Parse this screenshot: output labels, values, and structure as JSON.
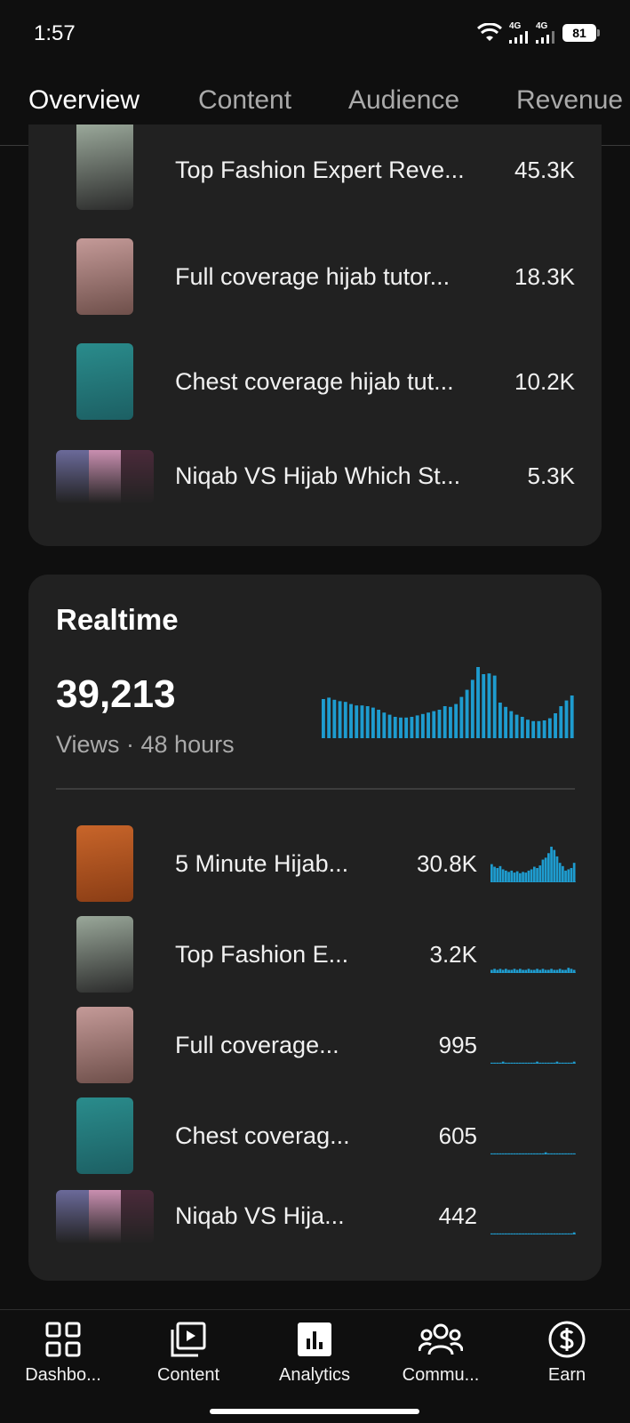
{
  "status": {
    "time": "1:57",
    "net1": "4G",
    "net2": "4G",
    "battery": "81"
  },
  "tabs": [
    {
      "label": "Overview",
      "active": true
    },
    {
      "label": "Content",
      "active": false
    },
    {
      "label": "Audience",
      "active": false
    },
    {
      "label": "Revenue",
      "active": false
    }
  ],
  "top_content": [
    {
      "title": "Top Fashion Expert Reve...",
      "value": "45.3K",
      "thumb": [
        "#9aa89a",
        "#2b2b2b"
      ]
    },
    {
      "title": "Full coverage hijab tutor...",
      "value": "18.3K",
      "thumb": [
        "#c49a98",
        "#6e4f4a"
      ]
    },
    {
      "title": "Chest coverage hijab tut...",
      "value": "10.2K",
      "thumb": [
        "#2a8c8c",
        "#1c5f63"
      ]
    },
    {
      "title": "Niqab VS Hijab Which St...",
      "value": "5.3K",
      "thumb": [
        "#6b6a9a",
        "#c98fb0",
        "#4a2a3a"
      ]
    }
  ],
  "realtime": {
    "title": "Realtime",
    "views": "39,213",
    "caption": "Views · 48 hours",
    "chart_color": "#1e9ccf",
    "chart_data": {
      "type": "bar",
      "values": [
        55,
        57,
        54,
        52,
        51,
        48,
        46,
        46,
        45,
        43,
        40,
        36,
        33,
        30,
        29,
        29,
        30,
        32,
        34,
        36,
        38,
        40,
        45,
        44,
        48,
        58,
        68,
        82,
        100,
        90,
        91,
        88,
        50,
        44,
        38,
        33,
        30,
        26,
        24,
        24,
        25,
        28,
        35,
        45,
        53,
        60
      ]
    },
    "items": [
      {
        "title": "5 Minute Hijab...",
        "value": "30.8K",
        "thumb": [
          "#c8652a",
          "#8a3d15"
        ],
        "spark": [
          28,
          24,
          22,
          25,
          20,
          18,
          16,
          18,
          15,
          17,
          14,
          16,
          15,
          18,
          20,
          24,
          22,
          26,
          35,
          38,
          45,
          55,
          50,
          40,
          30,
          25,
          18,
          20,
          22,
          30
        ]
      },
      {
        "title": "Top Fashion E...",
        "value": "3.2K",
        "thumb": [
          "#9aa89a",
          "#2b2b2b"
        ],
        "spark": [
          3,
          4,
          3,
          4,
          3,
          4,
          3,
          3,
          4,
          3,
          4,
          3,
          3,
          4,
          3,
          3,
          4,
          3,
          4,
          3,
          3,
          4,
          3,
          3,
          4,
          3,
          3,
          5,
          4,
          3
        ]
      },
      {
        "title": "Full coverage...",
        "value": "995",
        "thumb": [
          "#c49a98",
          "#6e4f4a"
        ],
        "spark": [
          1,
          1,
          1,
          1,
          2,
          1,
          1,
          1,
          1,
          1,
          1,
          1,
          1,
          1,
          1,
          1,
          2,
          1,
          1,
          1,
          1,
          1,
          1,
          2,
          1,
          1,
          1,
          1,
          1,
          2
        ]
      },
      {
        "title": "Chest coverag...",
        "value": "605",
        "thumb": [
          "#2a8c8c",
          "#1c5f63"
        ],
        "spark": [
          1,
          1,
          1,
          1,
          1,
          1,
          1,
          1,
          1,
          1,
          1,
          1,
          1,
          1,
          1,
          1,
          1,
          1,
          1,
          2,
          1,
          1,
          1,
          1,
          1,
          1,
          1,
          1,
          1,
          1
        ]
      },
      {
        "title": "Niqab VS Hija...",
        "value": "442",
        "thumb": [
          "#6b6a9a",
          "#c98fb0",
          "#4a2a3a"
        ],
        "spark": [
          1,
          1,
          1,
          1,
          1,
          1,
          1,
          1,
          1,
          1,
          1,
          1,
          1,
          1,
          1,
          1,
          1,
          1,
          1,
          1,
          1,
          1,
          1,
          1,
          1,
          1,
          1,
          1,
          1,
          2
        ]
      }
    ]
  },
  "nav": [
    {
      "label": "Dashbo...",
      "icon": "dashboard-icon"
    },
    {
      "label": "Content",
      "icon": "content-icon"
    },
    {
      "label": "Analytics",
      "icon": "analytics-icon"
    },
    {
      "label": "Commu...",
      "icon": "community-icon"
    },
    {
      "label": "Earn",
      "icon": "earn-icon"
    }
  ]
}
